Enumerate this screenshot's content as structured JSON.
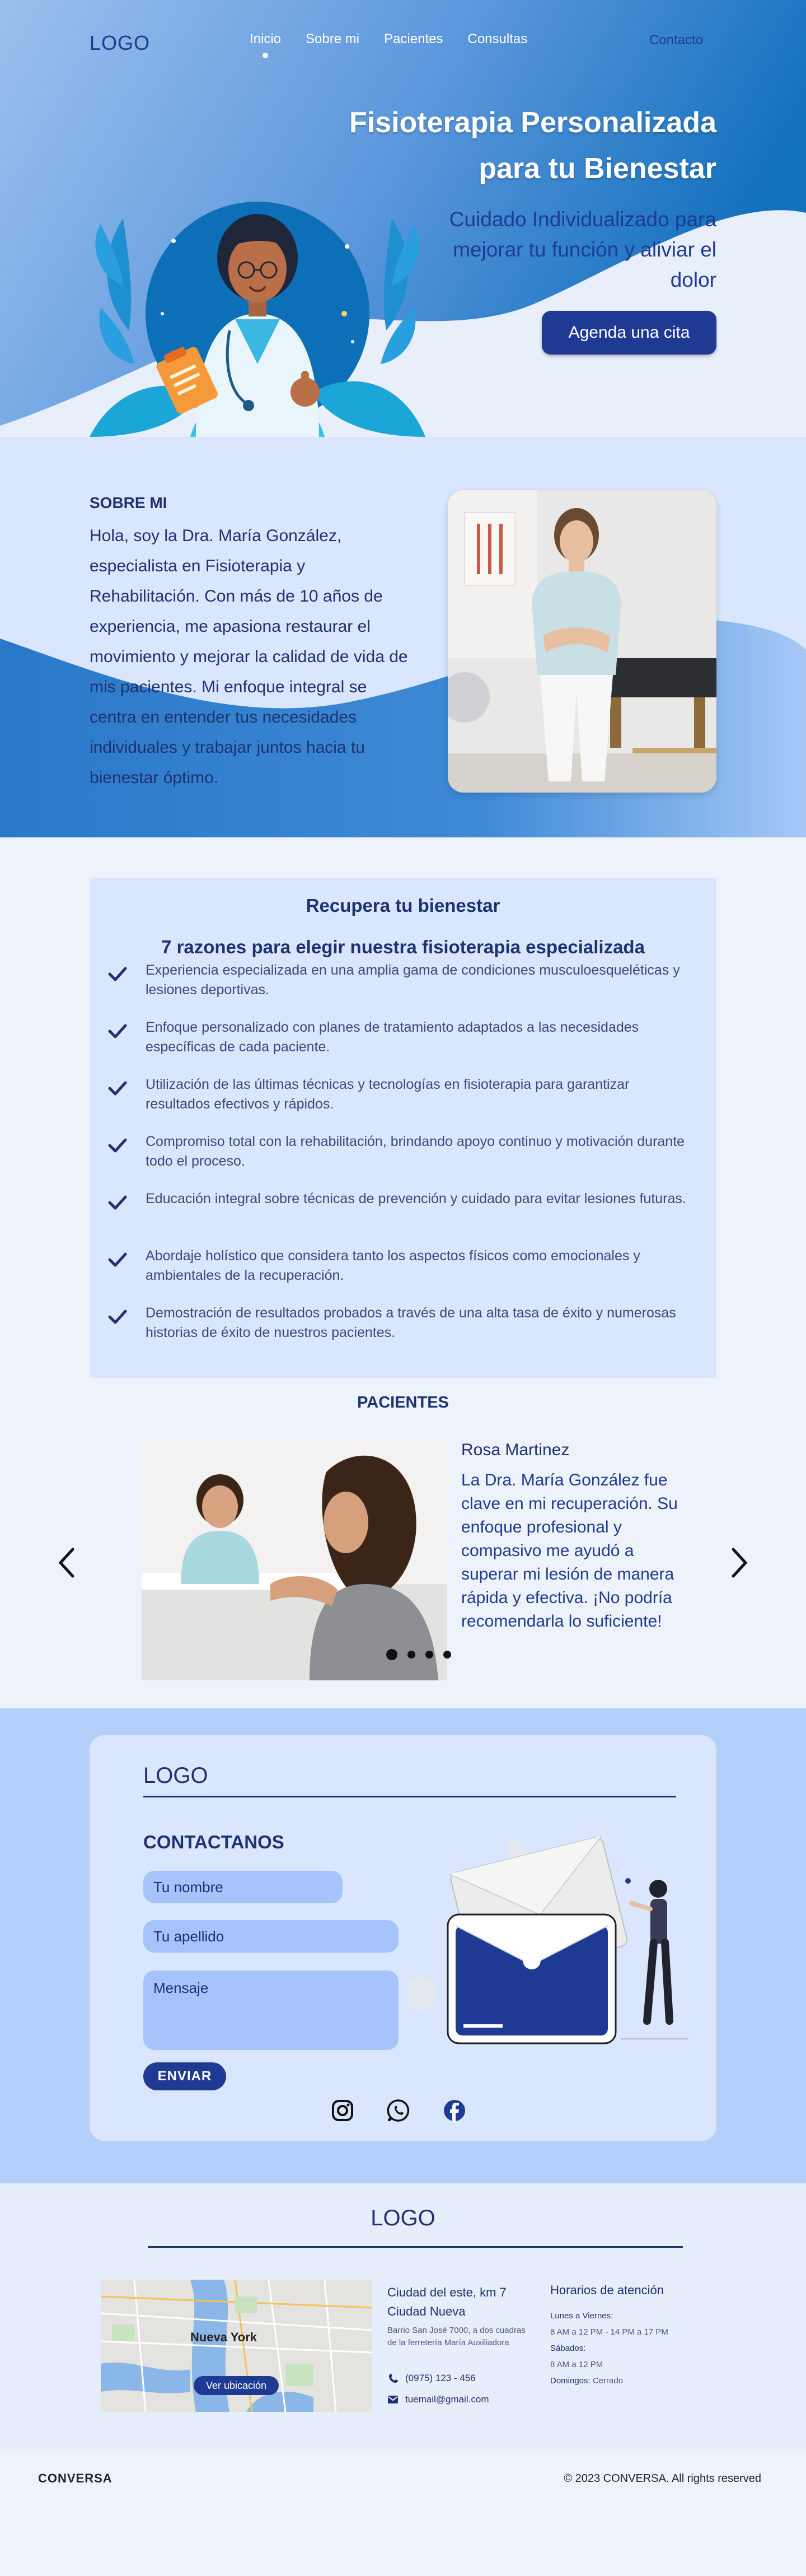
{
  "nav": {
    "logo": "LOGO",
    "links": [
      "Inicio",
      "Sobre mi",
      "Pacientes",
      "Consultas"
    ],
    "active": "Inicio",
    "contact": "Contacto"
  },
  "hero": {
    "title_line1": "Fisioterapia Personalizada",
    "title_line2": "para tu Bienestar",
    "subtitle": "Cuidado Individualizado para mejorar tu función y aliviar el dolor",
    "cta": "Agenda una cita"
  },
  "about": {
    "heading": "SOBRE MI",
    "text": "Hola, soy la Dra. María González, especialista en Fisioterapia y Rehabilitación. Con más de 10 años de experiencia, me apasiona restaurar el movimiento y mejorar la calidad de vida de mis pacientes. Mi enfoque integral se centra en entender tus necesidades individuales y trabajar juntos hacia tu bienestar óptimo."
  },
  "reasons": {
    "title": "Recupera tu bienestar",
    "subtitle": "7 razones para elegir nuestra fisioterapia especializada",
    "items": [
      "Experiencia especializada en una amplia gama de condiciones musculoesqueléticas y lesiones deportivas.",
      "Enfoque personalizado con planes de tratamiento adaptados a las necesidades específicas de cada paciente.",
      "Utilización de las últimas técnicas y tecnologías en fisioterapia para garantizar resultados efectivos y rápidos.",
      "Compromiso total con la rehabilitación, brindando apoyo continuo y motivación durante todo el proceso.",
      "Educación integral sobre técnicas de prevención y cuidado para evitar lesiones futuras.",
      "Abordaje holístico que considera tanto los aspectos físicos como emocionales y ambientales de la recuperación.",
      "Demostración de resultados probados a través de una alta tasa de éxito y numerosas historias de éxito de nuestros pacientes."
    ]
  },
  "patients": {
    "heading": "PACIENTES",
    "name": "Rosa Martinez",
    "quote": "La Dra. María González fue clave en mi recuperación. Su enfoque profesional y compasivo me ayudó a superar mi lesión de manera rápida y efectiva. ¡No podría recomendarla lo suficiente!",
    "slides": 4,
    "current": 1
  },
  "contact": {
    "logo": "LOGO",
    "heading": "CONTACTANOS",
    "placeholder_name": "Tu nombre",
    "placeholder_last": "Tu apellido",
    "placeholder_msg": "Mensaje",
    "send": "ENVIAR",
    "socials": [
      "instagram-icon",
      "whatsapp-icon",
      "facebook-icon"
    ]
  },
  "info": {
    "logo": "LOGO",
    "map_label": "Nueva York",
    "map_button": "Ver ubicación",
    "address_title": "Ciudad del este, km 7",
    "address_city": "Ciudad Nueva",
    "address_detail": "Barrio San José 7000, a dos cuadras de la ferretería María Auxiliadora",
    "phone": "(0975) 123 - 456",
    "email": "tuemail@gmail.com",
    "hours_title": "Horarios de atención",
    "hours": {
      "weekdays_label": "Lunes a Viernes:",
      "weekdays": "8 AM a 12 PM - 14 PM a 17 PM",
      "saturday_label": "Sábados:",
      "saturday": "8 AM a 12 PM",
      "sunday_label": "Domingos:",
      "sunday": "Cerrado"
    }
  },
  "footer": {
    "brand": "CONVERSA",
    "copyright": "© 2023 CONVERSA. All rights reserved"
  },
  "colors": {
    "primary": "#1f3a93",
    "hero_blue": "#2f7fd6",
    "panel": "#d9e6fd",
    "contact_bg": "#b3cffa"
  }
}
